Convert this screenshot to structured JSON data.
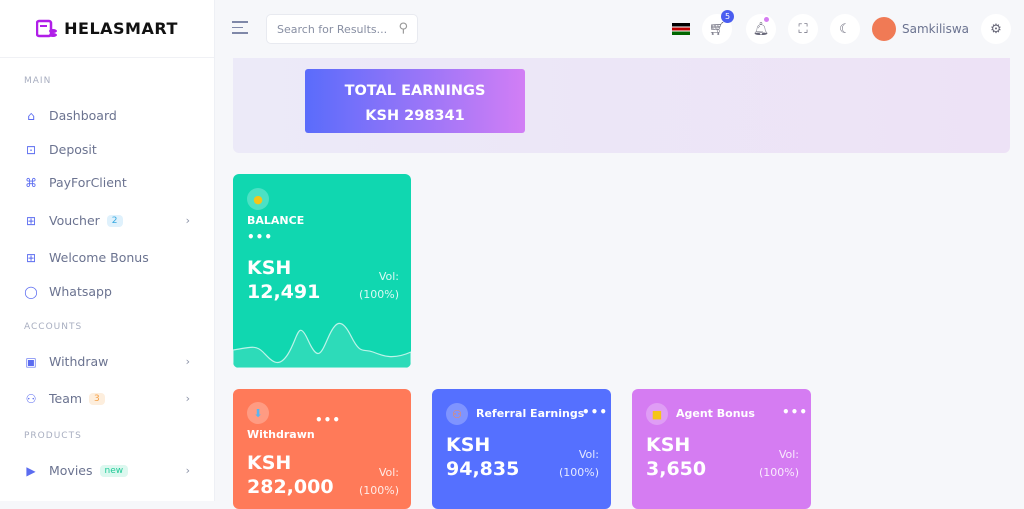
{
  "brand": {
    "name": "HELASMART",
    "logo_color": "#b01ee8"
  },
  "header": {
    "search_placeholder": "Search for Results...",
    "cart_count": "5",
    "username": "Samkiliswa"
  },
  "sidebar": {
    "sections": [
      {
        "title": "MAIN"
      },
      {
        "title": "ACCOUNTS"
      },
      {
        "title": "PRODUCTS"
      }
    ],
    "items": [
      {
        "label": "Dashboard",
        "icon": "home-icon"
      },
      {
        "label": "Deposit",
        "icon": "deposit-icon"
      },
      {
        "label": "PayForClient",
        "icon": "command-icon"
      },
      {
        "label": "Voucher",
        "icon": "gift-icon",
        "badge": "2"
      },
      {
        "label": "Welcome Bonus",
        "icon": "gift-icon"
      },
      {
        "label": "Whatsapp",
        "icon": "whatsapp-icon"
      },
      {
        "label": "Withdraw",
        "icon": "withdraw-icon"
      },
      {
        "label": "Team",
        "icon": "user-plus-icon",
        "badge": "3"
      },
      {
        "label": "Movies",
        "icon": "video-icon",
        "badge": "new"
      }
    ]
  },
  "total": {
    "title": "TOTAL EARNINGS",
    "value": "KSH 298341"
  },
  "cards": [
    {
      "label": "BALANCE",
      "currency": "KSH",
      "amount": "12,491",
      "vol_label": "Vol:",
      "vol": "(100%)",
      "color": "#10d7b0"
    },
    {
      "label": "Withdrawn",
      "currency": "KSH",
      "amount": "282,000",
      "vol_label": "Vol:",
      "vol": "(100%)",
      "color": "#ff7a59"
    },
    {
      "label": "Referral Earnings",
      "currency": "KSH",
      "amount": "94,835",
      "vol_label": "Vol:",
      "vol": "(100%)",
      "color": "#5570ff"
    },
    {
      "label": "Agent Bonus",
      "currency": "KSH",
      "amount": "3,650",
      "vol_label": "Vol:",
      "vol": "(100%)",
      "color": "#d57cf2"
    }
  ],
  "dots": "•••"
}
